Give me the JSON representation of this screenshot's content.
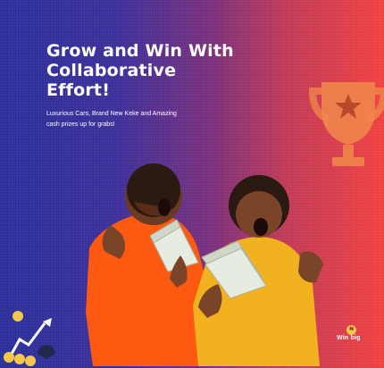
{
  "banner": {
    "headline": "Grow and Win With Collaborative Effort!",
    "subcopy": "Luxurious Cars, Brand New Keke and Amazing cash prizes up for grabs!",
    "brand_name": "Win big",
    "brand_badge": "₦",
    "colors": {
      "gradient_left": "#2a2f9a",
      "gradient_right": "#f0413f",
      "trophy": "#f08a4b",
      "hoodie_left": "#ff5a12",
      "hoodie_right": "#f2b11f"
    }
  },
  "icons": [
    "trophy-icon",
    "growth-chart-icon",
    "win-big-logo"
  ]
}
